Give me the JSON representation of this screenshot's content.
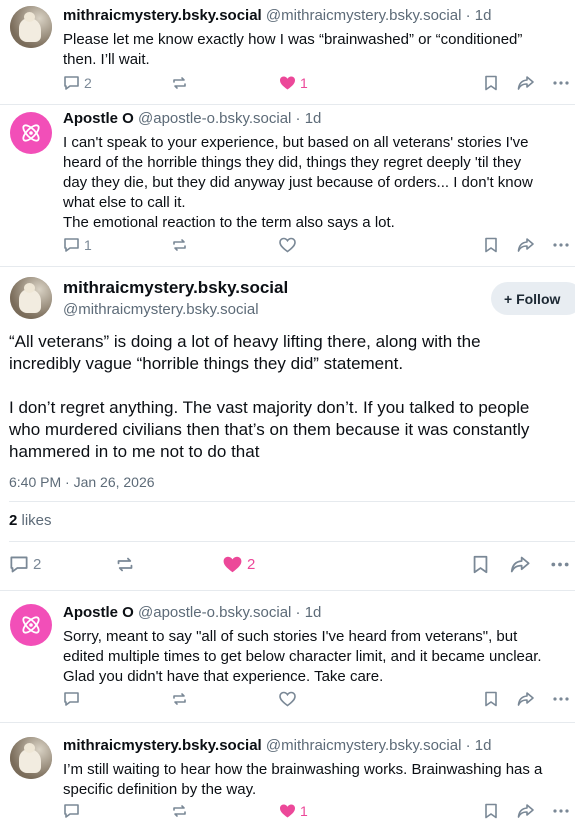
{
  "posts": [
    {
      "author": "mithraicmystery.bsky.social",
      "handle": "@mithraicmystery.bsky.social · 1d",
      "lines": [
        "Please let me know exactly how I was “brainwashed” or “conditioned”",
        "then. I’ll wait."
      ],
      "replies": "2",
      "likes": "1",
      "liked": true
    },
    {
      "author": "Apostle O",
      "handle": "@apostle-o.bsky.social · 1d",
      "lines": [
        "I can't speak to your experience, but based on all veterans' stories I've",
        "heard of the horrible things they did, things they regret deeply 'til they",
        "day they die, but they did anyway just because of orders... I don't know",
        "what else to call it.",
        "The emotional reaction to the term also says a lot."
      ],
      "replies": "1",
      "likes": "",
      "liked": false
    }
  ],
  "main_post": {
    "author": "mithraicmystery.bsky.social",
    "handle": "@mithraicmystery.bsky.social",
    "follow_label": "+ Follow",
    "lines": [
      "“All veterans” is doing a lot of heavy lifting there, along with the",
      "incredibly vague “horrible things they did” statement.",
      "",
      "I don’t regret anything. The vast majority don’t. If you talked to people",
      "who murdered civilians then that’s on them because it was constantly",
      "hammered in to me not to do that"
    ],
    "timestamp": "6:40 PM · Jan 26, 2026",
    "likes_count": "2",
    "likes_label": "likes",
    "replies": "2",
    "likes": "2"
  },
  "replies_below": [
    {
      "author": "Apostle O",
      "handle": "@apostle-o.bsky.social · 1d",
      "lines": [
        "Sorry, meant to say \"all of such stories I've heard from veterans\", but",
        "edited multiple times to get below character limit, and it became unclear.",
        "Glad you didn't have that experience. Take care."
      ],
      "replies": "",
      "likes": "",
      "liked": false
    },
    {
      "author": "mithraicmystery.bsky.social",
      "handle": "@mithraicmystery.bsky.social · 1d",
      "lines": [
        "I’m still waiting to hear how the brainwashing works. Brainwashing has a",
        "specific definition by the way."
      ],
      "replies": "",
      "likes": "1",
      "liked": true
    }
  ],
  "colors": {
    "accent_like": "#ec4899",
    "avatar_apostle": "#f24fb8",
    "muted": "#7a8896"
  }
}
